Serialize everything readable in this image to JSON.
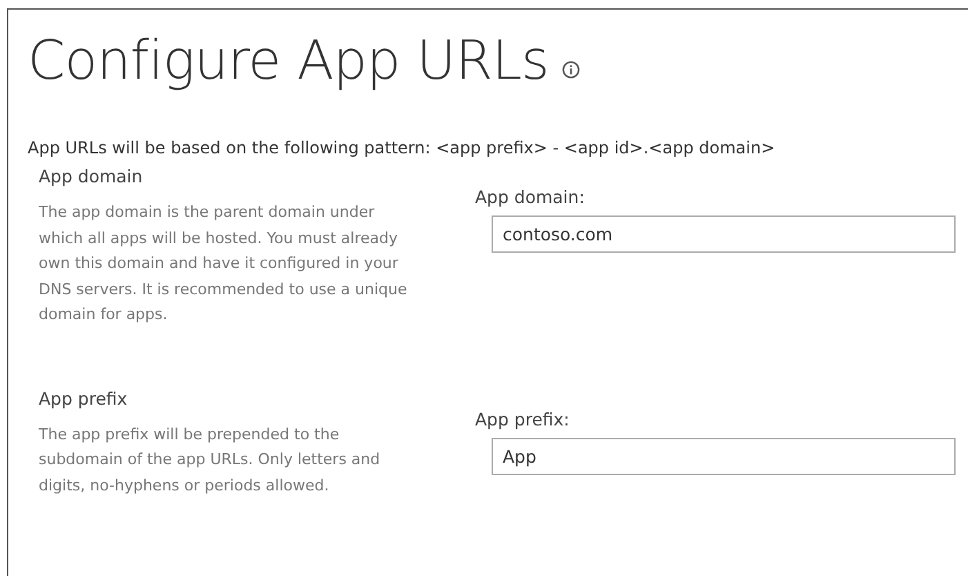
{
  "title": "Configure App URLs",
  "pattern_text": "App URLs will be based on the following pattern: <app prefix> - <app id>.<app domain>",
  "sections": [
    {
      "heading": "App domain",
      "description": "The app domain is the parent domain under which all apps will be hosted. You must already own this domain and have it configured in your DNS servers. It is recommended to use a unique domain for apps.",
      "field_label": "App domain:",
      "value": "contoso.com"
    },
    {
      "heading": "App prefix",
      "description": "The app prefix will be prepended to the subdomain of the app URLs. Only letters and digits, no-hyphens or periods allowed.",
      "field_label": "App prefix:",
      "value": "App"
    }
  ]
}
